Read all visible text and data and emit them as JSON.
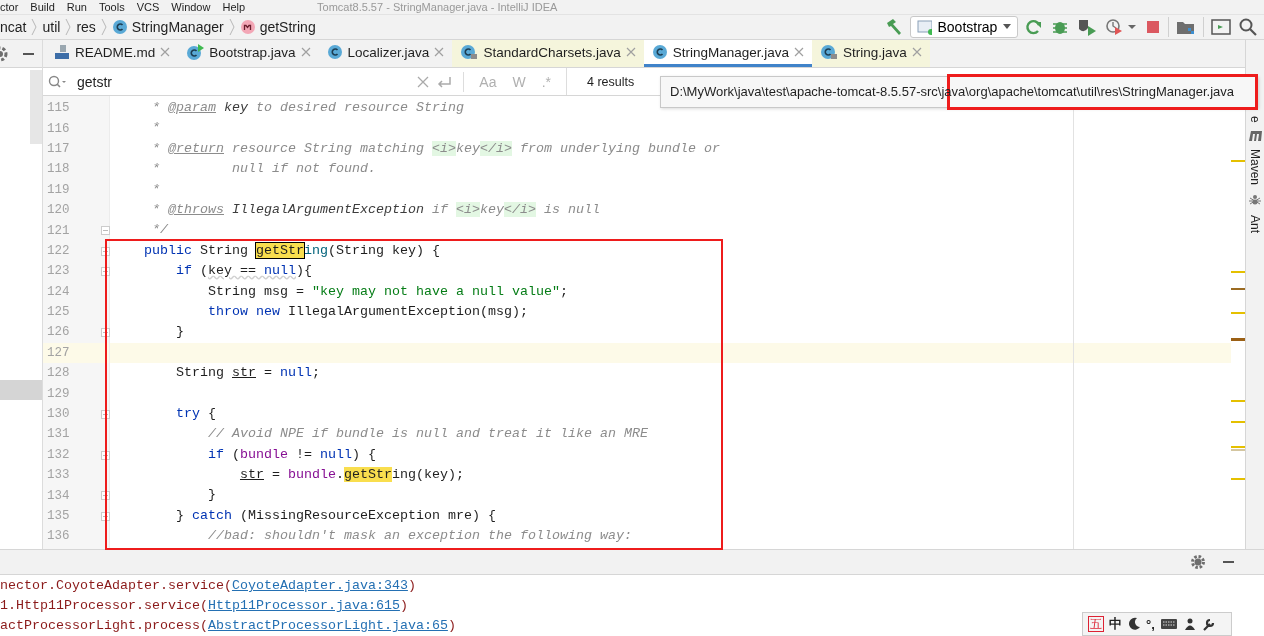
{
  "menu_bar": {
    "items": [
      "ctor",
      "Build",
      "Run",
      "Tools",
      "VCS",
      "Window",
      "Help"
    ],
    "title": "Tomcat8.5.57 - StringManager.java - IntelliJ IDEA"
  },
  "breadcrumb": [
    {
      "label": "ncat",
      "kind": "folder"
    },
    {
      "label": "util",
      "kind": "folder"
    },
    {
      "label": "res",
      "kind": "folder"
    },
    {
      "label": "StringManager",
      "kind": "class"
    },
    {
      "label": "getString",
      "kind": "method"
    }
  ],
  "run_config": {
    "label": "Bootstrap"
  },
  "tabs": [
    {
      "label": "README.md",
      "kind": "markdown",
      "library": false,
      "selected": false
    },
    {
      "label": "Bootstrap.java",
      "kind": "runnable",
      "library": false,
      "selected": false
    },
    {
      "label": "Localizer.java",
      "kind": "class",
      "library": false,
      "selected": false
    },
    {
      "label": "StandardCharsets.java",
      "kind": "locked",
      "library": true,
      "selected": false
    },
    {
      "label": "StringManager.java",
      "kind": "class",
      "library": false,
      "selected": true
    },
    {
      "label": "String.java",
      "kind": "locked",
      "library": true,
      "selected": false
    }
  ],
  "find_bar": {
    "value": "getstr",
    "options": [
      "Aa",
      "W",
      ".*"
    ],
    "results": "4 results"
  },
  "tooltip": {
    "path": "D:\\MyWork\\java\\test\\apache-tomcat-8.5.57-src\\java\\org\\apache\\tomcat\\util\\res\\StringManager.java"
  },
  "editor": {
    "lines": [
      {
        "number": "115",
        "fold": false,
        "current": false,
        "segments": [
          {
            "kind": "cm",
            "text": "     * "
          },
          {
            "kind": "tag",
            "text": "@param"
          },
          {
            "kind": "dref",
            "text": " key"
          },
          {
            "kind": "cm",
            "text": " to desired resource String"
          }
        ]
      },
      {
        "number": "116",
        "fold": false,
        "current": false,
        "segments": [
          {
            "kind": "cm",
            "text": "     *"
          }
        ]
      },
      {
        "number": "117",
        "fold": false,
        "current": false,
        "segments": [
          {
            "kind": "cm",
            "text": "     * "
          },
          {
            "kind": "tag",
            "text": "@return"
          },
          {
            "kind": "cm",
            "text": " resource String matching "
          },
          {
            "kind": "html",
            "text": "<i>"
          },
          {
            "kind": "cm",
            "text": "key"
          },
          {
            "kind": "html",
            "text": "</i>"
          },
          {
            "kind": "cm",
            "text": " from underlying bundle or"
          }
        ]
      },
      {
        "number": "118",
        "fold": false,
        "current": false,
        "segments": [
          {
            "kind": "cm",
            "text": "     *         null if not found."
          }
        ]
      },
      {
        "number": "119",
        "fold": false,
        "current": false,
        "segments": [
          {
            "kind": "cm",
            "text": "     *"
          }
        ]
      },
      {
        "number": "120",
        "fold": false,
        "current": false,
        "segments": [
          {
            "kind": "cm",
            "text": "     * "
          },
          {
            "kind": "tag",
            "text": "@throws"
          },
          {
            "kind": "dref",
            "text": " IllegalArgumentException"
          },
          {
            "kind": "cm",
            "text": " if "
          },
          {
            "kind": "html",
            "text": "<i>"
          },
          {
            "kind": "cm",
            "text": "key"
          },
          {
            "kind": "html",
            "text": "</i>"
          },
          {
            "kind": "cm",
            "text": " is null"
          }
        ]
      },
      {
        "number": "121",
        "fold": true,
        "current": false,
        "segments": [
          {
            "kind": "cm",
            "text": "     */"
          }
        ]
      },
      {
        "number": "122",
        "fold": true,
        "current": false,
        "segments": [
          {
            "kind": "kw",
            "text": "    public"
          },
          {
            "kind": "t",
            "text": " String "
          },
          {
            "kind": "matchcur",
            "text": "getStr"
          },
          {
            "kind": "decl",
            "text": "ing"
          },
          {
            "kind": "t",
            "text": "(String key) {"
          }
        ]
      },
      {
        "number": "123",
        "fold": true,
        "current": false,
        "segments": [
          {
            "kind": "kw",
            "text": "        if"
          },
          {
            "kind": "t",
            "text": " ("
          },
          {
            "kind": "warn",
            "text": "key == "
          },
          {
            "kind": "warnkw",
            "text": "null"
          },
          {
            "kind": "t",
            "text": "){"
          }
        ]
      },
      {
        "number": "124",
        "fold": false,
        "current": false,
        "segments": [
          {
            "kind": "t",
            "text": "            String msg = "
          },
          {
            "kind": "str",
            "text": "\"key may not have a null value\""
          },
          {
            "kind": "t",
            "text": ";"
          }
        ]
      },
      {
        "number": "125",
        "fold": false,
        "current": false,
        "segments": [
          {
            "kind": "kw",
            "text": "            throw new"
          },
          {
            "kind": "t",
            "text": " IllegalArgumentException(msg);"
          }
        ]
      },
      {
        "number": "126",
        "fold": true,
        "current": false,
        "segments": [
          {
            "kind": "t",
            "text": "        }"
          }
        ]
      },
      {
        "number": "127",
        "fold": false,
        "current": true
      },
      {
        "number": "128",
        "fold": false,
        "current": false,
        "segments": [
          {
            "kind": "t",
            "text": "        String "
          },
          {
            "kind": "var",
            "text": "str"
          },
          {
            "kind": "t",
            "text": " = "
          },
          {
            "kind": "kw",
            "text": "null"
          },
          {
            "kind": "t",
            "text": ";"
          }
        ]
      },
      {
        "number": "129",
        "fold": false,
        "current": false
      },
      {
        "number": "130",
        "fold": true,
        "current": false,
        "segments": [
          {
            "kind": "kw",
            "text": "        try"
          },
          {
            "kind": "t",
            "text": " {"
          }
        ]
      },
      {
        "number": "131",
        "fold": false,
        "current": false,
        "segments": [
          {
            "kind": "cm",
            "text": "            // Avoid NPE if bundle is null and treat it like an MRE"
          }
        ]
      },
      {
        "number": "132",
        "fold": true,
        "current": false,
        "segments": [
          {
            "kind": "kw",
            "text": "            if"
          },
          {
            "kind": "t",
            "text": " ("
          },
          {
            "kind": "fld",
            "text": "bundle"
          },
          {
            "kind": "t",
            "text": " != "
          },
          {
            "kind": "kw",
            "text": "null"
          },
          {
            "kind": "t",
            "text": ") {"
          }
        ]
      },
      {
        "number": "133",
        "fold": false,
        "current": false,
        "segments": [
          {
            "kind": "var",
            "text": "                str"
          },
          {
            "kind": "t",
            "text": " = "
          },
          {
            "kind": "fld",
            "text": "bundle"
          },
          {
            "kind": "t",
            "text": "."
          },
          {
            "kind": "match",
            "text": "getStr"
          },
          {
            "kind": "t",
            "text": "ing(key);"
          }
        ]
      },
      {
        "number": "134",
        "fold": true,
        "current": false,
        "segments": [
          {
            "kind": "t",
            "text": "            }"
          }
        ]
      },
      {
        "number": "135",
        "fold": true,
        "current": false,
        "segments": [
          {
            "kind": "t",
            "text": "        } "
          },
          {
            "kind": "kw",
            "text": "catch"
          },
          {
            "kind": "t",
            "text": " (MissingResourceException mre) {"
          }
        ]
      },
      {
        "number": "136",
        "fold": false,
        "current": false,
        "segments": [
          {
            "kind": "cm",
            "text": "            //bad: shouldn't mask an exception the following way:"
          }
        ]
      }
    ]
  },
  "right_stripe": [
    "e",
    "Maven",
    "Ant"
  ],
  "console": [
    {
      "text": "nector.CoyoteAdapter.service(",
      "link": "CoyoteAdapter.java:343",
      "end": ")"
    },
    {
      "text": "1.Http11Processor.service(",
      "link": "Http11Processor.java:615",
      "end": ")"
    },
    {
      "text": "actProcessorLight.process(",
      "link": "AbstractProcessorLight.java:65",
      "end": ")"
    }
  ],
  "ime_bar": {
    "mode": "五",
    "language": "中",
    "punctuation": "°,"
  }
}
